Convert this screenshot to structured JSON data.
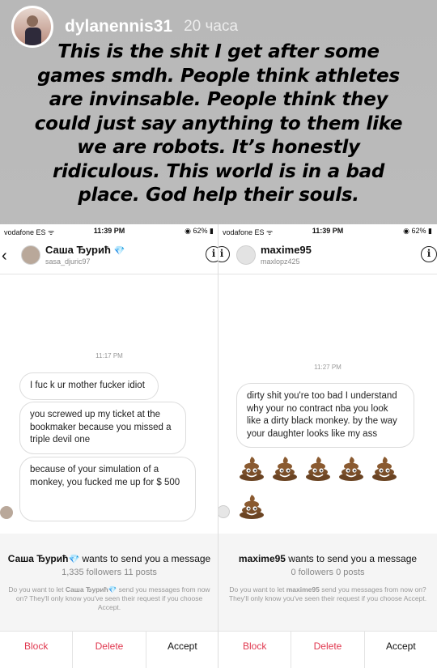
{
  "story": {
    "username": "dylanennis31",
    "time": "20 часа",
    "caption_lines": [
      "This is the shit I get after some",
      "games smdh. People think athletes",
      "are invinsable. People think they",
      "could just say anything to them like",
      "we are robots. It’s honestly",
      "ridiculous. This world is in a bad",
      "place. God help their souls."
    ]
  },
  "left": {
    "status": {
      "carrier": "vodafone ES ᯤ",
      "time": "11:39 PM",
      "battery": "◉ 62% ▮"
    },
    "header": {
      "name": "Саша Ђурић",
      "gem": "💎",
      "handle": "sasa_djuric97"
    },
    "timestamp": "11:17 PM",
    "messages": [
      "I fuc k ur mother fucker idiot",
      "you screwed up my ticket at the bookmaker because you missed a triple devil one",
      "because of your simulation of a monkey, you fucked me up for $ 500"
    ],
    "request": {
      "name": "Саша Ђурић",
      "gem": "💎",
      "text": " wants to send you a message",
      "stats": "1,335 followers 11 posts",
      "note_pre": "Do you want to let ",
      "note_name": "Саша Ђурић💎",
      "note_post": " send you messages from now on? They'll only know you've seen their request if you choose Accept."
    },
    "actions": {
      "block": "Block",
      "delete": "Delete",
      "accept": "Accept"
    }
  },
  "right": {
    "status": {
      "carrier": "vodafone ES ᯤ",
      "time": "11:39 PM",
      "battery": "◉ 62% ▮"
    },
    "header": {
      "name": "maxime95",
      "handle": "maxlopz425"
    },
    "timestamp": "11:27 PM",
    "messages": [
      "dirty shit you're too bad I understand why your no contract nba you look like a dirty black monkey. by the way your daughter looks like my ass"
    ],
    "emoji_icon": "pile-of-poo",
    "request": {
      "name": "maxime95",
      "text": " wants to send you a message",
      "stats": "0 followers 0 posts",
      "note_pre": "Do you want to let ",
      "note_name": "maxime95",
      "note_post": " send you messages from now on? They'll only know you've seen their request if you choose Accept."
    },
    "actions": {
      "block": "Block",
      "delete": "Delete",
      "accept": "Accept"
    }
  },
  "colors": {
    "danger": "#e0384f",
    "gem": "#3aa0f0",
    "request_bg": "#f5f5f5"
  }
}
